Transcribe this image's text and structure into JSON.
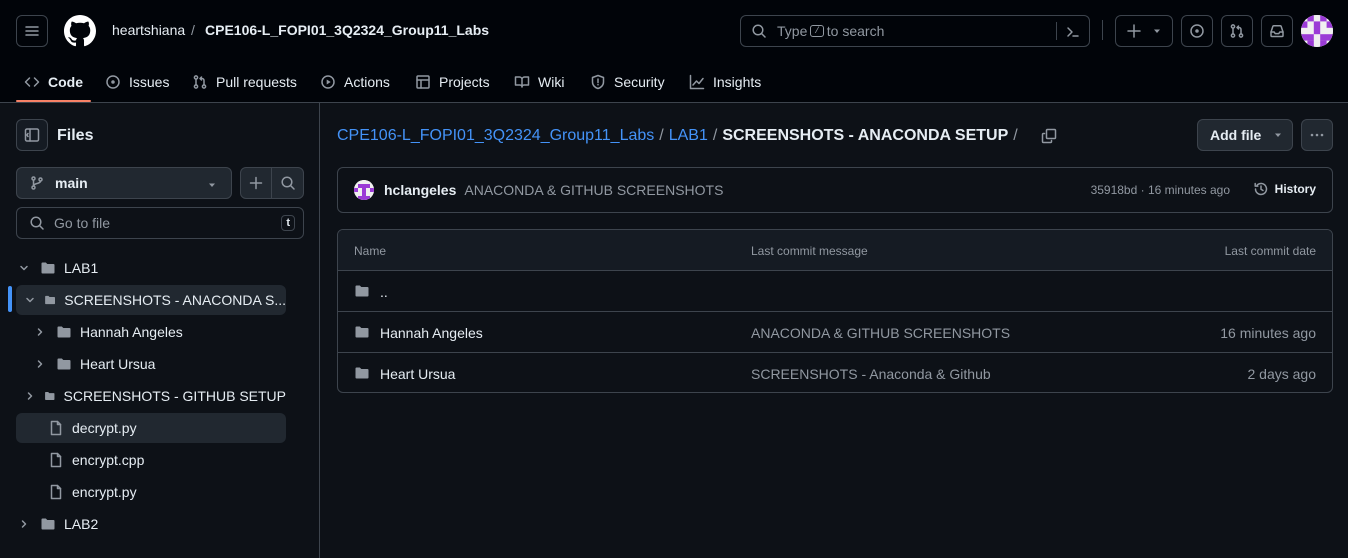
{
  "header": {
    "owner": "heartshiana",
    "separator": "/",
    "repo": "CPE106-L_FOPI01_3Q2324_Group11_Labs",
    "search_prefix": "Type",
    "search_key": "/",
    "search_suffix": "to search"
  },
  "tabs": [
    {
      "label": "Code",
      "icon": "code-icon",
      "active": true
    },
    {
      "label": "Issues",
      "icon": "issue-icon"
    },
    {
      "label": "Pull requests",
      "icon": "pull-request-icon"
    },
    {
      "label": "Actions",
      "icon": "play-icon"
    },
    {
      "label": "Projects",
      "icon": "table-icon"
    },
    {
      "label": "Wiki",
      "icon": "book-icon"
    },
    {
      "label": "Security",
      "icon": "shield-icon"
    },
    {
      "label": "Insights",
      "icon": "graph-icon"
    }
  ],
  "sidebar": {
    "title": "Files",
    "branch": "main",
    "go_to_file": "Go to file",
    "go_to_file_key": "t",
    "tree": [
      {
        "label": "LAB1",
        "type": "folder",
        "expanded": true
      },
      {
        "label": "SCREENSHOTS - ANACONDA S...",
        "type": "folder",
        "expanded": true,
        "selected": true
      },
      {
        "label": "Hannah Angeles",
        "type": "folder"
      },
      {
        "label": "Heart Ursua",
        "type": "folder"
      },
      {
        "label": "SCREENSHOTS - GITHUB SETUP",
        "type": "folder"
      },
      {
        "label": "decrypt.py",
        "type": "file",
        "hover": true
      },
      {
        "label": "encrypt.cpp",
        "type": "file"
      },
      {
        "label": "encrypt.py",
        "type": "file"
      },
      {
        "label": "LAB2",
        "type": "folder"
      }
    ]
  },
  "breadcrumb": {
    "repo": "CPE106-L_FOPI01_3Q2324_Group11_Labs",
    "folder": "LAB1",
    "current": "SCREENSHOTS - ANACONDA SETUP",
    "separator": "/"
  },
  "actions": {
    "add_file": "Add file"
  },
  "latest_commit": {
    "author": "hclangeles",
    "message": "ANACONDA & GITHUB SCREENSHOTS",
    "hash_time": "35918bd · 16 minutes ago",
    "history_label": "History"
  },
  "table": {
    "headers": {
      "name": "Name",
      "message": "Last commit message",
      "date": "Last commit date"
    },
    "parent": "..",
    "rows": [
      {
        "name": "Hannah Angeles",
        "message": "ANACONDA & GITHUB SCREENSHOTS",
        "date": "16 minutes ago"
      },
      {
        "name": "Heart Ursua",
        "message": "SCREENSHOTS - Anaconda & Github",
        "date": "2 days ago"
      }
    ]
  },
  "colors": {
    "background": "#0d1117",
    "header_bg": "#010409",
    "accent_link": "#4493f8",
    "active_tab_underline": "#f78166",
    "avatar_purple": "#9b3bd6"
  }
}
